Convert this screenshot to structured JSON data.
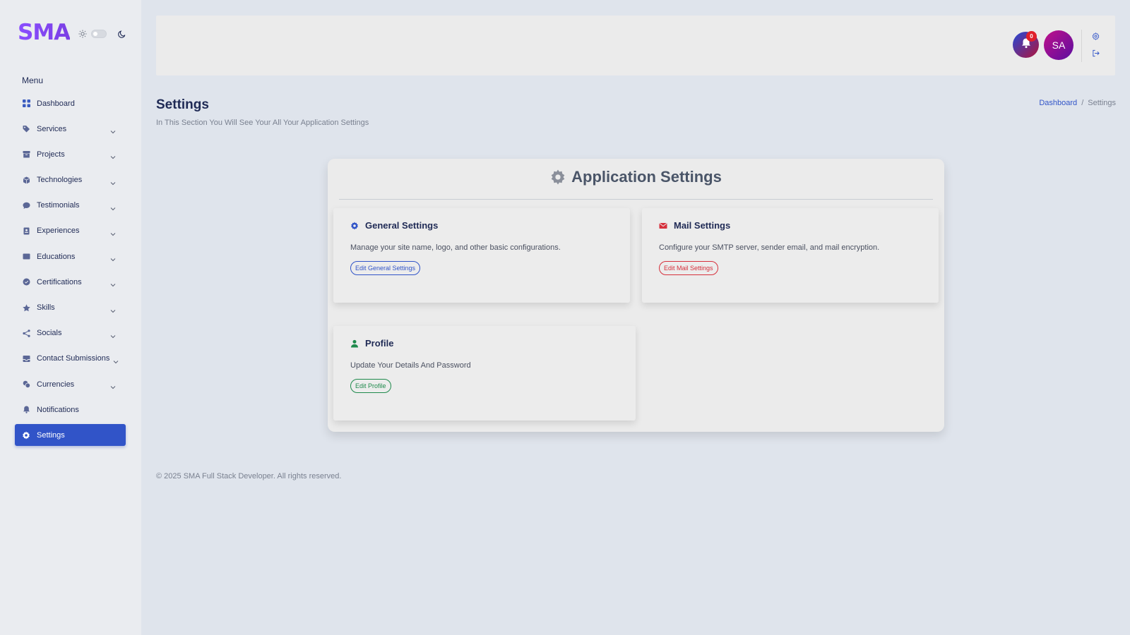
{
  "brand": {
    "name": "SMA"
  },
  "sidebar": {
    "menu_title": "Menu",
    "items": [
      {
        "label": "Dashboard",
        "icon": "grid-icon",
        "has_chevron": false
      },
      {
        "label": "Services",
        "icon": "tag-icon",
        "has_chevron": true
      },
      {
        "label": "Projects",
        "icon": "box-icon",
        "has_chevron": true
      },
      {
        "label": "Technologies",
        "icon": "cube-icon",
        "has_chevron": true
      },
      {
        "label": "Testimonials",
        "icon": "chat-icon",
        "has_chevron": true
      },
      {
        "label": "Experiences",
        "icon": "badge-icon",
        "has_chevron": true
      },
      {
        "label": "Educations",
        "icon": "book-icon",
        "has_chevron": true
      },
      {
        "label": "Certifications",
        "icon": "certificate-icon",
        "has_chevron": true
      },
      {
        "label": "Skills",
        "icon": "star-icon",
        "has_chevron": true
      },
      {
        "label": "Socials",
        "icon": "share-icon",
        "has_chevron": true
      },
      {
        "label": "Contact Submissions",
        "icon": "inbox-icon",
        "has_chevron": true
      },
      {
        "label": "Currencies",
        "icon": "coins-icon",
        "has_chevron": true
      },
      {
        "label": "Notifications",
        "icon": "bell-icon",
        "has_chevron": false
      },
      {
        "label": "Settings",
        "icon": "gear-icon",
        "has_chevron": false,
        "active": true
      }
    ]
  },
  "header": {
    "notification_count": "0",
    "avatar_initials": "SA"
  },
  "page": {
    "title": "Settings",
    "subtitle": "In This Section You Will See Your All Your Application Settings",
    "breadcrumb": {
      "home": "Dashboard",
      "separator": "/",
      "current": "Settings"
    }
  },
  "panel": {
    "title": "Application Settings",
    "cards": {
      "general": {
        "title": "General Settings",
        "description": "Manage your site name, logo, and other basic configurations.",
        "button": "Edit General Settings",
        "color": "#3154c8"
      },
      "mail": {
        "title": "Mail Settings",
        "description": "Configure your SMTP server, sender email, and mail encryption.",
        "button": "Edit Mail Settings",
        "color": "#d6303c"
      },
      "profile": {
        "title": "Profile",
        "description": "Update Your Details And Password",
        "button": "Edit Profile",
        "color": "#1f8a4c"
      }
    }
  },
  "footer": {
    "text": "© 2025 SMA Full Stack Developer. All rights reserved."
  },
  "colors": {
    "accent": "#3154c8",
    "background": "#dfe4ec",
    "sidebar": "#eaecf0",
    "text": "#1f2a55"
  }
}
